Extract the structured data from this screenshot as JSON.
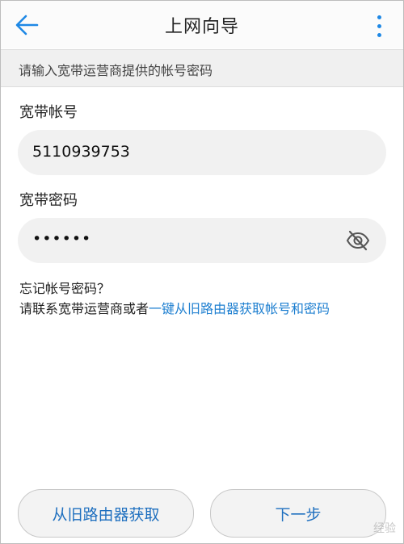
{
  "header": {
    "title": "上网向导",
    "back_icon": "arrow-left-icon",
    "more_icon": "more-vertical-icon",
    "accent_color": "#1e88e5"
  },
  "notice": "请输入宽带运营商提供的帐号密码",
  "account": {
    "label": "宽带帐号",
    "value": "5110939753"
  },
  "password": {
    "label": "宽带密码",
    "value": "••••••",
    "toggle_icon": "eye-off-icon"
  },
  "help": {
    "line1": "忘记帐号密码？",
    "line2_prefix": "请联系宽带运营商或者",
    "line2_link": "一键从旧路由器获取帐号和密码"
  },
  "buttons": {
    "left": "从旧路由器获取",
    "right": "下一步"
  },
  "watermark": "经验"
}
